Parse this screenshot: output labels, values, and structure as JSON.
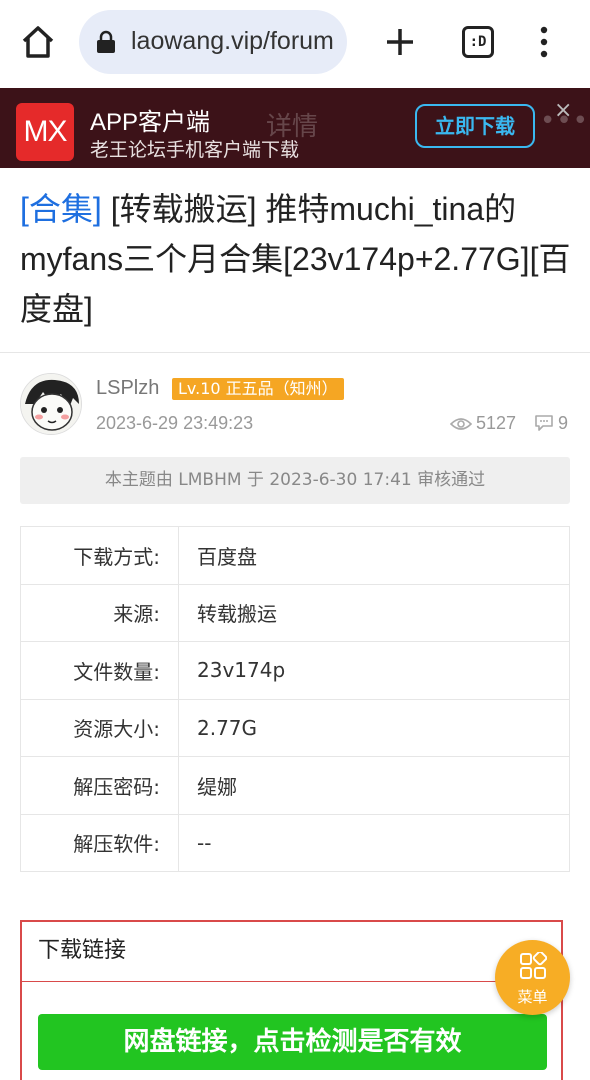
{
  "browser": {
    "url": "laowang.vip/forum",
    "tab_label": ":D"
  },
  "banner": {
    "logo": "MX",
    "title": "APP客户端",
    "subtitle": "老王论坛手机客户端下载",
    "detail_label": "详情",
    "download_label": "立即下载",
    "more_label": "•••",
    "close_label": "×"
  },
  "post": {
    "tag": "[合集]",
    "title": " [转载搬运] 推特muchi_tina的myfans三个月合集[23v174p+2.77G][百度盘]",
    "author": "LSPlzh",
    "level": "Lv.10 正五品（知州）",
    "time": "2023-6-29 23:49:23",
    "views": "5127",
    "replies": "9",
    "review_notice": "本主题由 LMBHM 于 2023-6-30 17:41 审核通过"
  },
  "info_rows": [
    {
      "key": "下载方式:",
      "value": "百度盘"
    },
    {
      "key": "来源:",
      "value": "转载搬运"
    },
    {
      "key": "文件数量:",
      "value": "23v174p"
    },
    {
      "key": "资源大小:",
      "value": "2.77G"
    },
    {
      "key": "解压密码:",
      "value": "缇娜"
    },
    {
      "key": "解压软件:",
      "value": "--"
    }
  ],
  "download": {
    "header": "下载链接",
    "netdisk_button": "网盘链接，点击检测是否有效"
  },
  "fab": {
    "label": "菜单"
  },
  "colors": {
    "banner_bg": "#3c1218",
    "accent_blue": "#1e6fe0",
    "badge": "#f5a623",
    "download_green": "#22c521",
    "box_border": "#d94a4a",
    "fab": "#f7ad25"
  }
}
